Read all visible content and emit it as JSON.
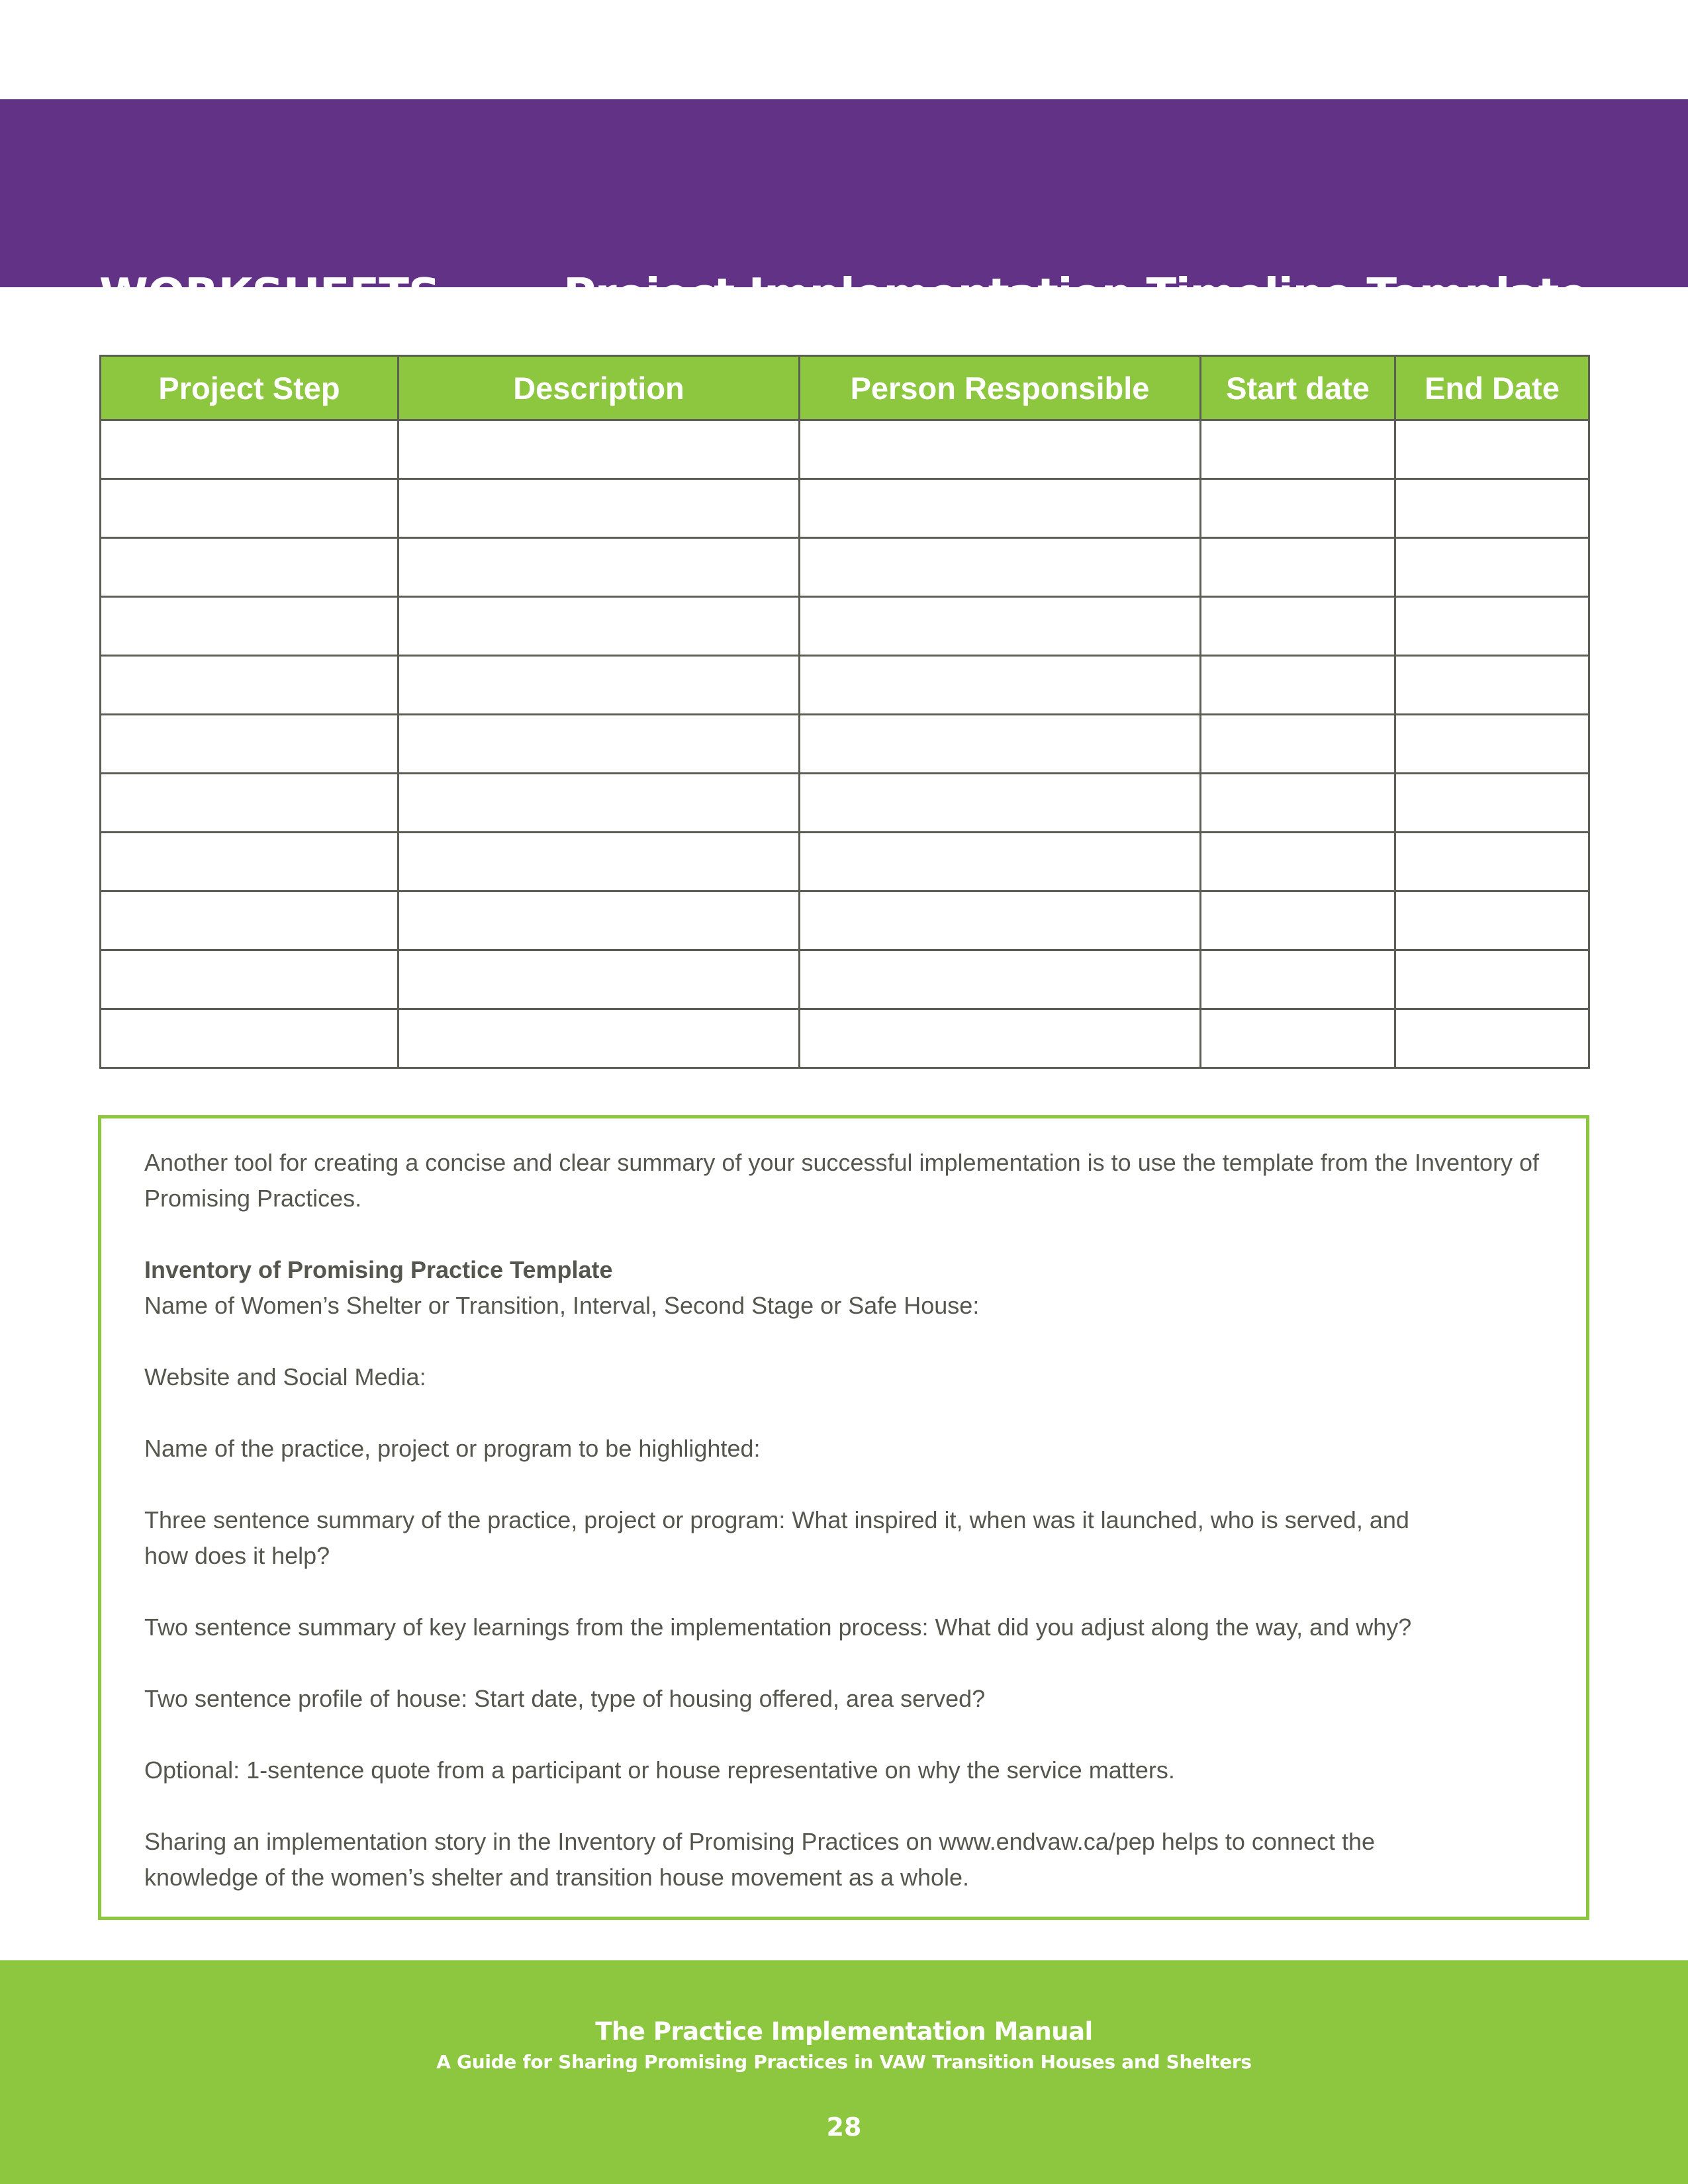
{
  "banner": {
    "section": "WORKSHEETS",
    "title": "Project Implementation Timeline Template",
    "color": "#623287"
  },
  "timeline_table": {
    "columns": [
      "Project Step",
      "Description",
      "Person Responsible",
      "Start date",
      "End Date"
    ],
    "rows": [
      [
        "",
        "",
        "",
        "",
        ""
      ],
      [
        "",
        "",
        "",
        "",
        ""
      ],
      [
        "",
        "",
        "",
        "",
        ""
      ],
      [
        "",
        "",
        "",
        "",
        ""
      ],
      [
        "",
        "",
        "",
        "",
        ""
      ],
      [
        "",
        "",
        "",
        "",
        ""
      ],
      [
        "",
        "",
        "",
        "",
        ""
      ],
      [
        "",
        "",
        "",
        "",
        ""
      ],
      [
        "",
        "",
        "",
        "",
        ""
      ],
      [
        "",
        "",
        "",
        "",
        ""
      ],
      [
        "",
        "",
        "",
        "",
        ""
      ]
    ],
    "header_color": "#8dc63f"
  },
  "summary": {
    "intro": "Another tool for creating a concise and clear summary of your successful implementation is to use the template from the Inventory of Promising Practices.",
    "template_heading": "Inventory of Promising Practice Template",
    "fields": [
      "Name of Women’s Shelter or Transition, Interval, Second Stage or Safe House:",
      "Website and Social Media:",
      "Name of the practice, project or program to be highlighted:",
      "Three sentence summary of the practice, project or program: What inspired it, when was it launched, who is served, and how does it help?",
      "Two sentence summary of key learnings from the implementation process: What did you adjust along the way, and why?",
      "Two sentence profile of house: Start date, type of housing offered, area served?",
      "Optional: 1-sentence quote from a participant or house representative on why the service matters."
    ],
    "closing": "Sharing an implementation story in the Inventory of Promising Practices on www.endvaw.ca/pep helps to connect the knowledge of the women’s shelter and transition house movement as a whole."
  },
  "footer": {
    "title": "The Practice Implementation Manual",
    "subtitle": "A Guide for Sharing Promising Practices in VAW Transition Houses and Shelters",
    "page_number": "28",
    "color": "#8dc63f"
  }
}
